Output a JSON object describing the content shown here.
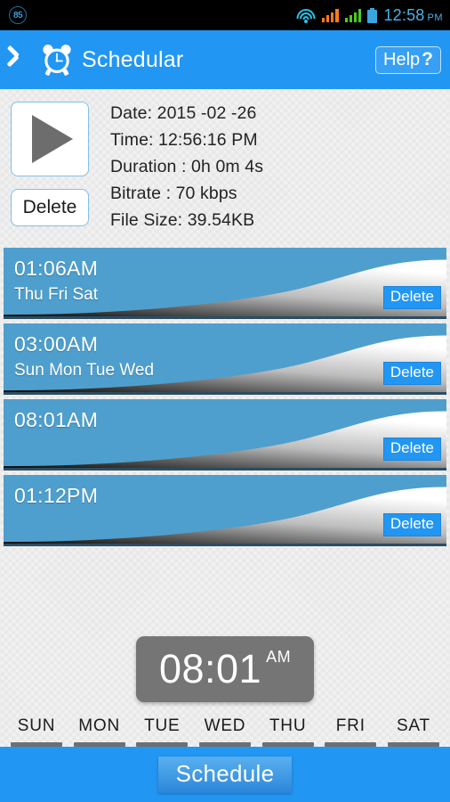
{
  "statusbar": {
    "left_badge": "85",
    "icons": [
      "wifi-icon",
      "signal-orange-icon",
      "signal-green-icon",
      "battery-icon"
    ],
    "time": "12:58",
    "ampm": "PM"
  },
  "header": {
    "back_icon": "chevron-left-icon",
    "app_icon": "alarm-clock-icon",
    "title": "Schedular",
    "help_label": "Help",
    "help_mark": "?",
    "bg_color": "#2196f3"
  },
  "info": {
    "play_label": "play-icon",
    "delete_label": "Delete",
    "lines": [
      "Date: 2015 -02 -26",
      "Time: 12:56:16 PM",
      "Duration : 0h 0m 4s",
      "Bitrate : 70 kbps",
      "File Size: 39.54KB"
    ]
  },
  "schedules": {
    "delete_label": "Delete",
    "row_color": "#4e9fcd",
    "items": [
      {
        "time": "01:06AM",
        "days": "Thu Fri Sat"
      },
      {
        "time": "03:00AM",
        "days": "Sun Mon Tue Wed"
      },
      {
        "time": "08:01AM",
        "days": ""
      },
      {
        "time": "01:12PM",
        "days": ""
      }
    ]
  },
  "picker": {
    "time": "08:01",
    "ampm": "AM",
    "pill_color": "#757575"
  },
  "days": {
    "items": [
      {
        "label": "SUN",
        "selected": false
      },
      {
        "label": "MON",
        "selected": false
      },
      {
        "label": "TUE",
        "selected": false
      },
      {
        "label": "WED",
        "selected": false
      },
      {
        "label": "THU",
        "selected": false
      },
      {
        "label": "FRI",
        "selected": false
      },
      {
        "label": "SAT",
        "selected": false
      }
    ]
  },
  "footer": {
    "schedule_label": "Schedule"
  }
}
